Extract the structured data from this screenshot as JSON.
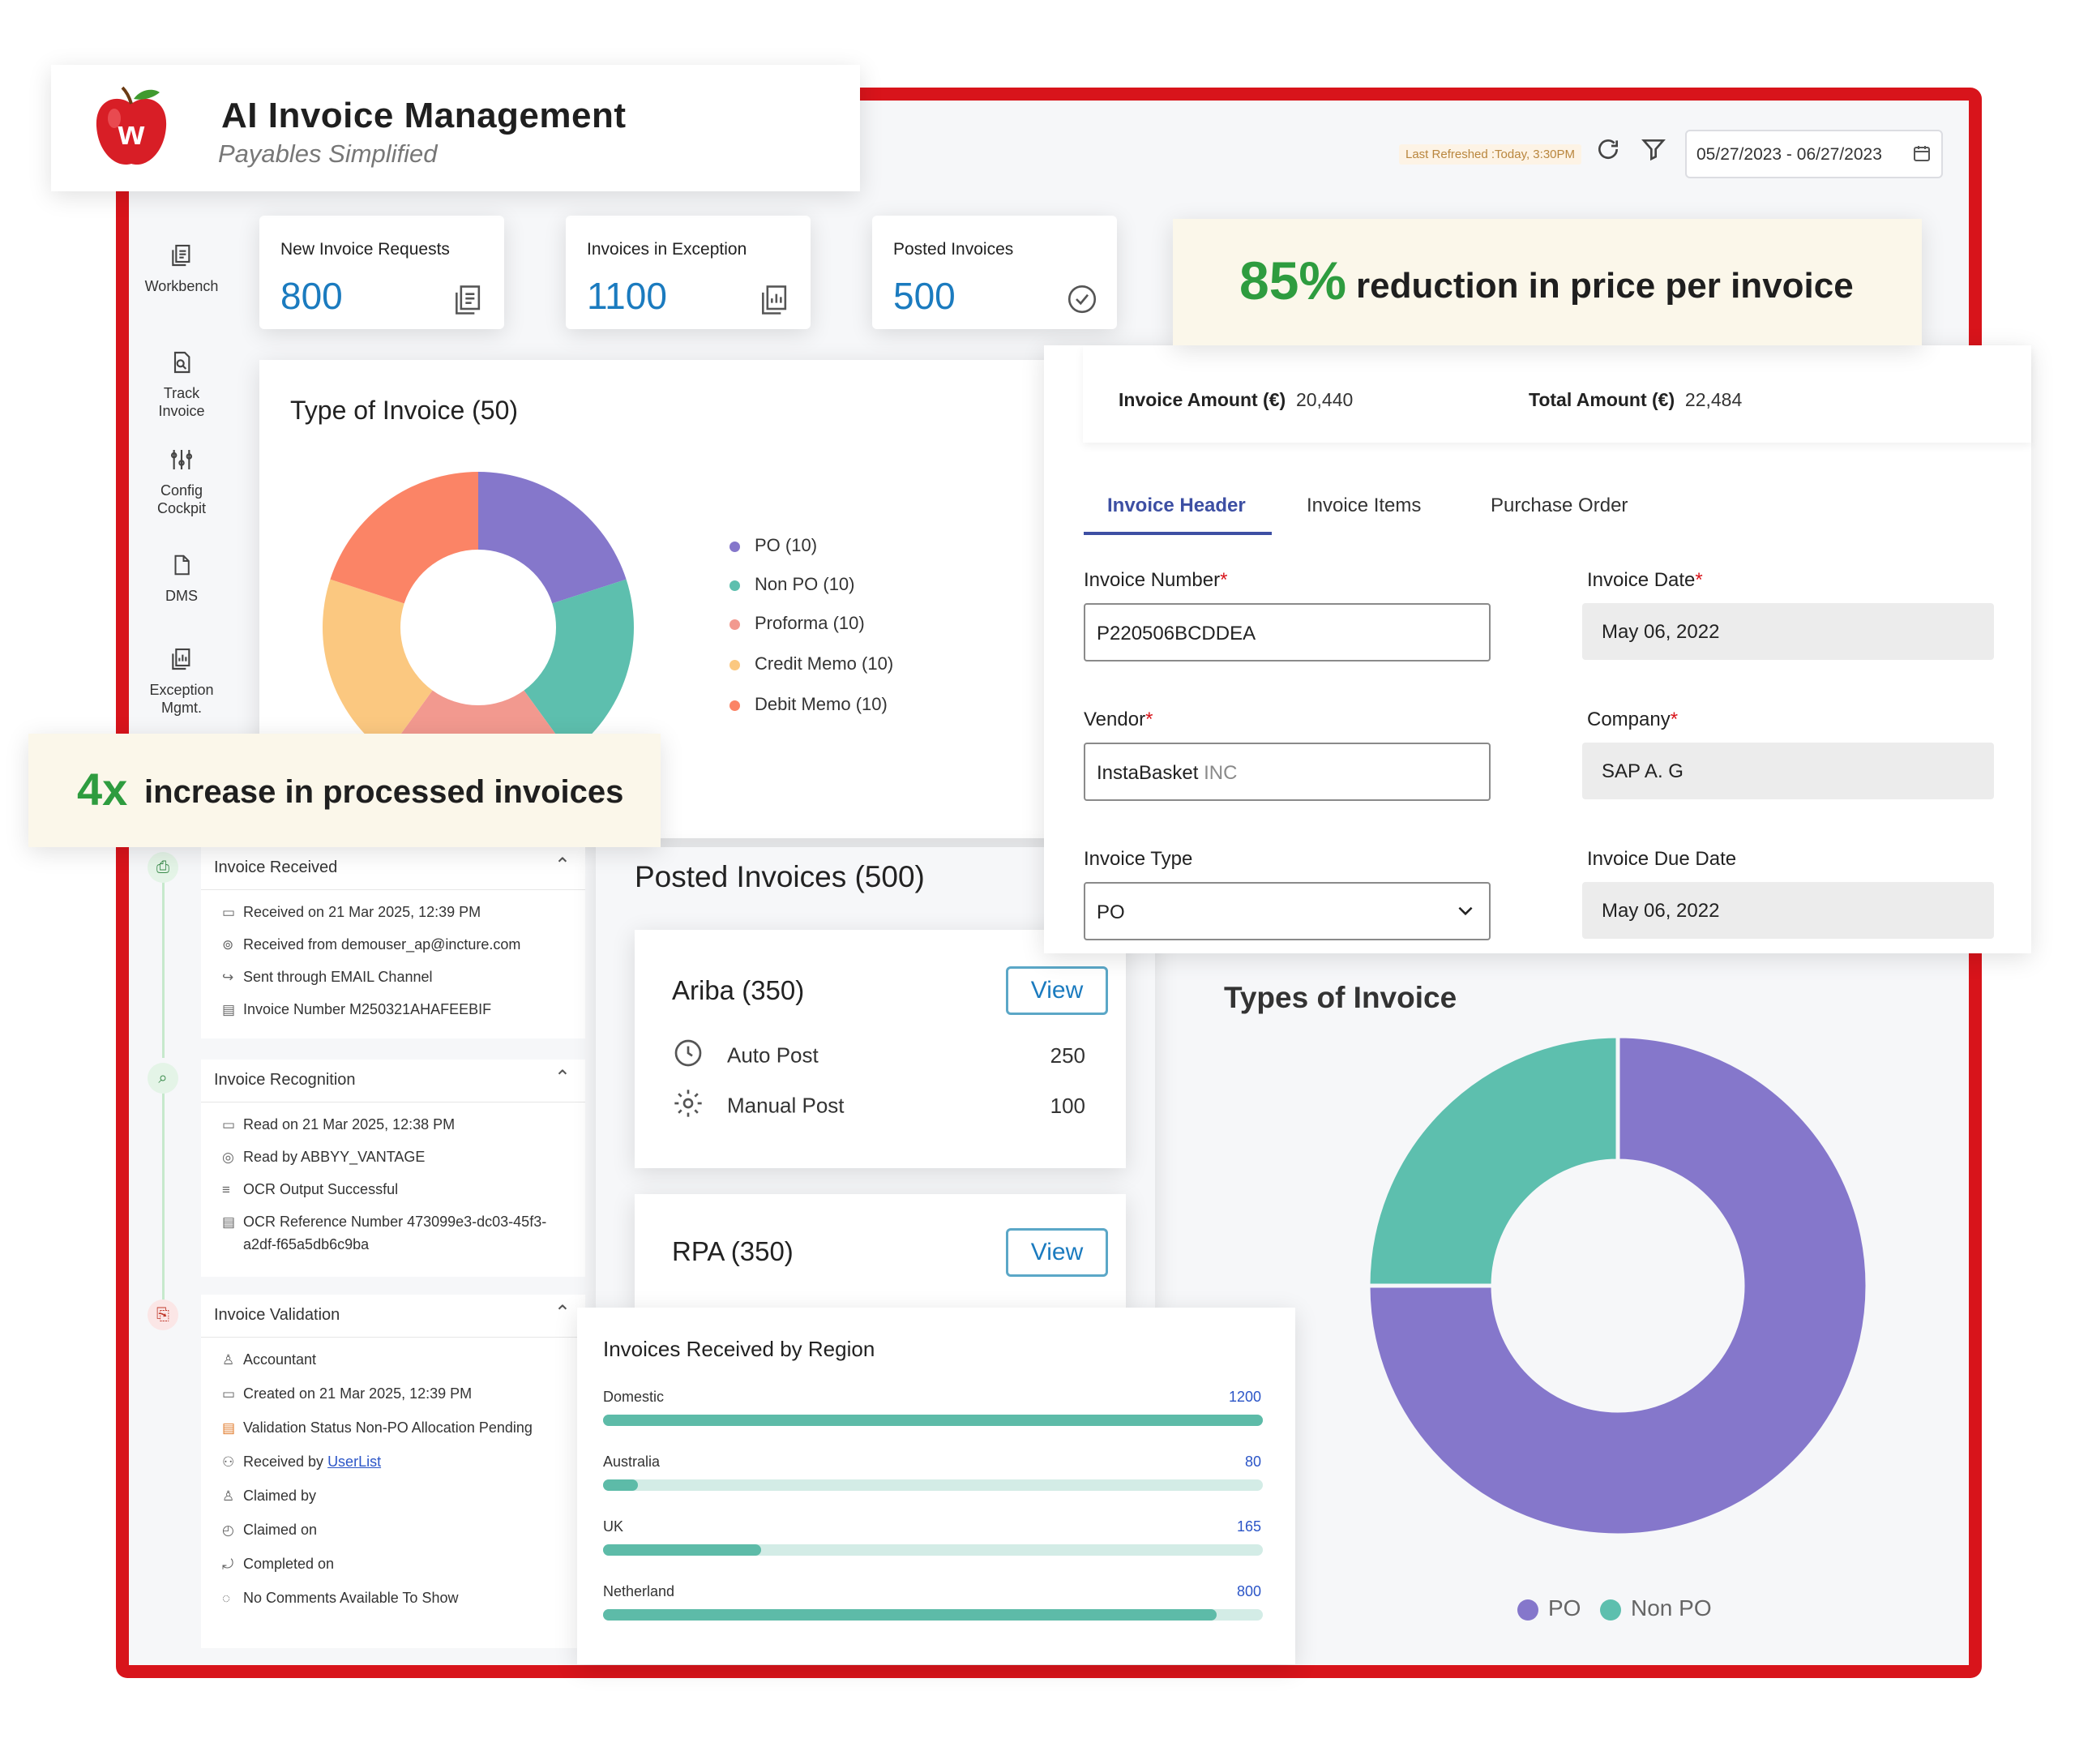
{
  "app": {
    "title": "AI Invoice Management",
    "subtitle": "Payables Simplified",
    "logo_letter": "w"
  },
  "topbar": {
    "last_refreshed": "Last Refreshed :Today, 3:30PM",
    "date_range": "05/27/2023 - 06/27/2023",
    "icons": [
      "refresh-icon",
      "filter-icon",
      "calendar-icon"
    ]
  },
  "sidebar": {
    "items": [
      {
        "label": "Workbench",
        "icon": "document-icon"
      },
      {
        "label": "Track Invoice",
        "icon": "search-document-icon"
      },
      {
        "label": "Config Cockpit",
        "icon": "sliders-icon"
      },
      {
        "label": "DMS",
        "icon": "file-icon"
      },
      {
        "label": "Exception Mgmt.",
        "icon": "chart-document-icon"
      }
    ]
  },
  "stats": [
    {
      "label": "New Invoice Requests",
      "value": "800"
    },
    {
      "label": "Invoices in Exception",
      "value": "1100"
    },
    {
      "label": "Posted Invoices",
      "value": "500"
    }
  ],
  "callouts": {
    "reduction": {
      "big": "85%",
      "text": "reduction in price per invoice"
    },
    "increase": {
      "big": "4x",
      "text": "increase in processed invoices"
    }
  },
  "type_of_invoice": {
    "title": "Type of Invoice (50)",
    "legend": [
      "PO (10)",
      "Non PO (10)",
      "Proforma (10)",
      "Credit Memo (10)",
      "Debit Memo (10)"
    ]
  },
  "form": {
    "invoice_amount_label": "Invoice Amount (€)",
    "invoice_amount_value": "20,440",
    "total_amount_label": "Total Amount (€)",
    "total_amount_value": "22,484",
    "tabs": [
      "Invoice Header",
      "Invoice Items",
      "Purchase Order"
    ],
    "fields": {
      "invoice_number_label": "Invoice Number",
      "invoice_number_value": "P220506BCDDEA",
      "invoice_date_label": "Invoice Date",
      "invoice_date_value": "May 06, 2022",
      "vendor_label": "Vendor",
      "vendor_value_main": "InstaBasket",
      "vendor_value_suffix": " INC",
      "company_label": "Company",
      "company_value": "SAP A. G",
      "invoice_type_label": "Invoice Type",
      "invoice_type_value": "PO",
      "due_date_label": "Invoice Due Date",
      "due_date_value": "May 06, 2022"
    },
    "required_marker": "*"
  },
  "timeline": [
    {
      "title": "Invoice Received",
      "rows": [
        "Received on 21 Mar 2025, 12:39 PM",
        "Received from demouser_ap@incture.com",
        "Sent through EMAIL Channel",
        "Invoice Number M250321AHAFEEBIF"
      ]
    },
    {
      "title": "Invoice Recognition",
      "rows": [
        "Read on 21 Mar 2025, 12:38 PM",
        "Read by ABBYY_VANTAGE",
        "OCR Output Successful",
        "OCR Reference Number 473099e3-dc03-45f3-",
        "a2df-f65a5db6c9ba"
      ]
    },
    {
      "title": "Invoice Validation",
      "rows": [
        "Accountant",
        "Created on 21 Mar 2025, 12:39 PM",
        "Validation Status Non-PO Allocation Pending",
        "Received by ",
        "Claimed by",
        "Claimed on",
        "Completed on",
        "No Comments Available To Show"
      ],
      "received_by_link": "UserList"
    }
  ],
  "posted": {
    "title": "Posted Invoices (500)",
    "ariba": {
      "name": "Ariba (350)",
      "view": "View",
      "auto_label": "Auto Post",
      "auto_value": "250",
      "manual_label": "Manual Post",
      "manual_value": "100"
    },
    "rpa": {
      "name": "RPA (350)",
      "view": "View"
    }
  },
  "region": {
    "title": "Invoices Received by Region",
    "items": [
      {
        "name": "Domestic",
        "value": "1200",
        "fill": 1.0
      },
      {
        "name": "Australia",
        "value": "80",
        "fill": 0.053
      },
      {
        "name": "UK",
        "value": "165",
        "fill": 0.24
      },
      {
        "name": "Netherland",
        "value": "800",
        "fill": 0.93
      }
    ]
  },
  "types_of_invoice_2": {
    "title": "Types of Invoice",
    "legend": [
      "PO",
      "Non PO"
    ]
  },
  "colors": {
    "frame": "#d8141b",
    "po": "#8577cb",
    "non_po": "#5dbfae",
    "proforma": "#f2998f",
    "credit_memo": "#fbc880",
    "debit_memo": "#fb8466",
    "accent_blue": "#1b7bbf",
    "green": "#2e9c3f"
  },
  "chart_data": [
    {
      "type": "pie",
      "title": "Type of Invoice (50)",
      "categories": [
        "PO",
        "Non PO",
        "Proforma",
        "Credit Memo",
        "Debit Memo"
      ],
      "values": [
        10,
        10,
        10,
        10,
        10
      ]
    },
    {
      "type": "pie",
      "title": "Types of Invoice",
      "categories": [
        "PO",
        "Non PO"
      ],
      "values": [
        75,
        25
      ]
    },
    {
      "type": "bar",
      "title": "Invoices Received by Region",
      "categories": [
        "Domestic",
        "Australia",
        "UK",
        "Netherland"
      ],
      "values": [
        1200,
        80,
        165,
        800
      ]
    }
  ]
}
